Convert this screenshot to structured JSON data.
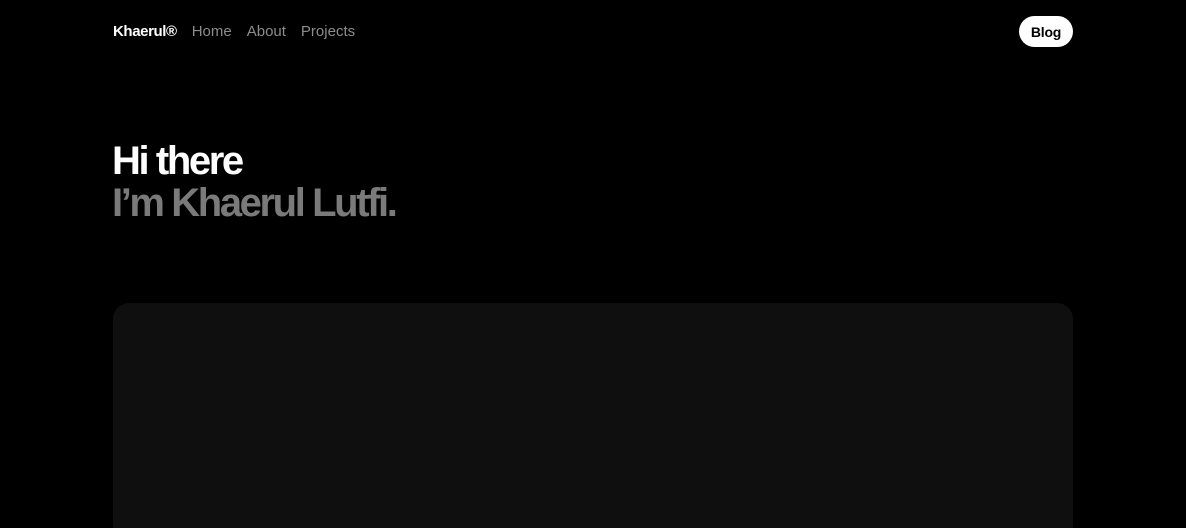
{
  "nav": {
    "logo": "Khaerul®",
    "links": [
      "Home",
      "About",
      "Projects"
    ],
    "blog_label": "Blog"
  },
  "hero": {
    "line1": "Hi there",
    "line2": "I’m Khaerul Lutfi."
  },
  "colors": {
    "background": "#000000",
    "card": "#0f0f0f",
    "muted_text": "#8c8c8c",
    "hero_muted": "#7a7a7a",
    "button_bg": "#ffffff"
  }
}
